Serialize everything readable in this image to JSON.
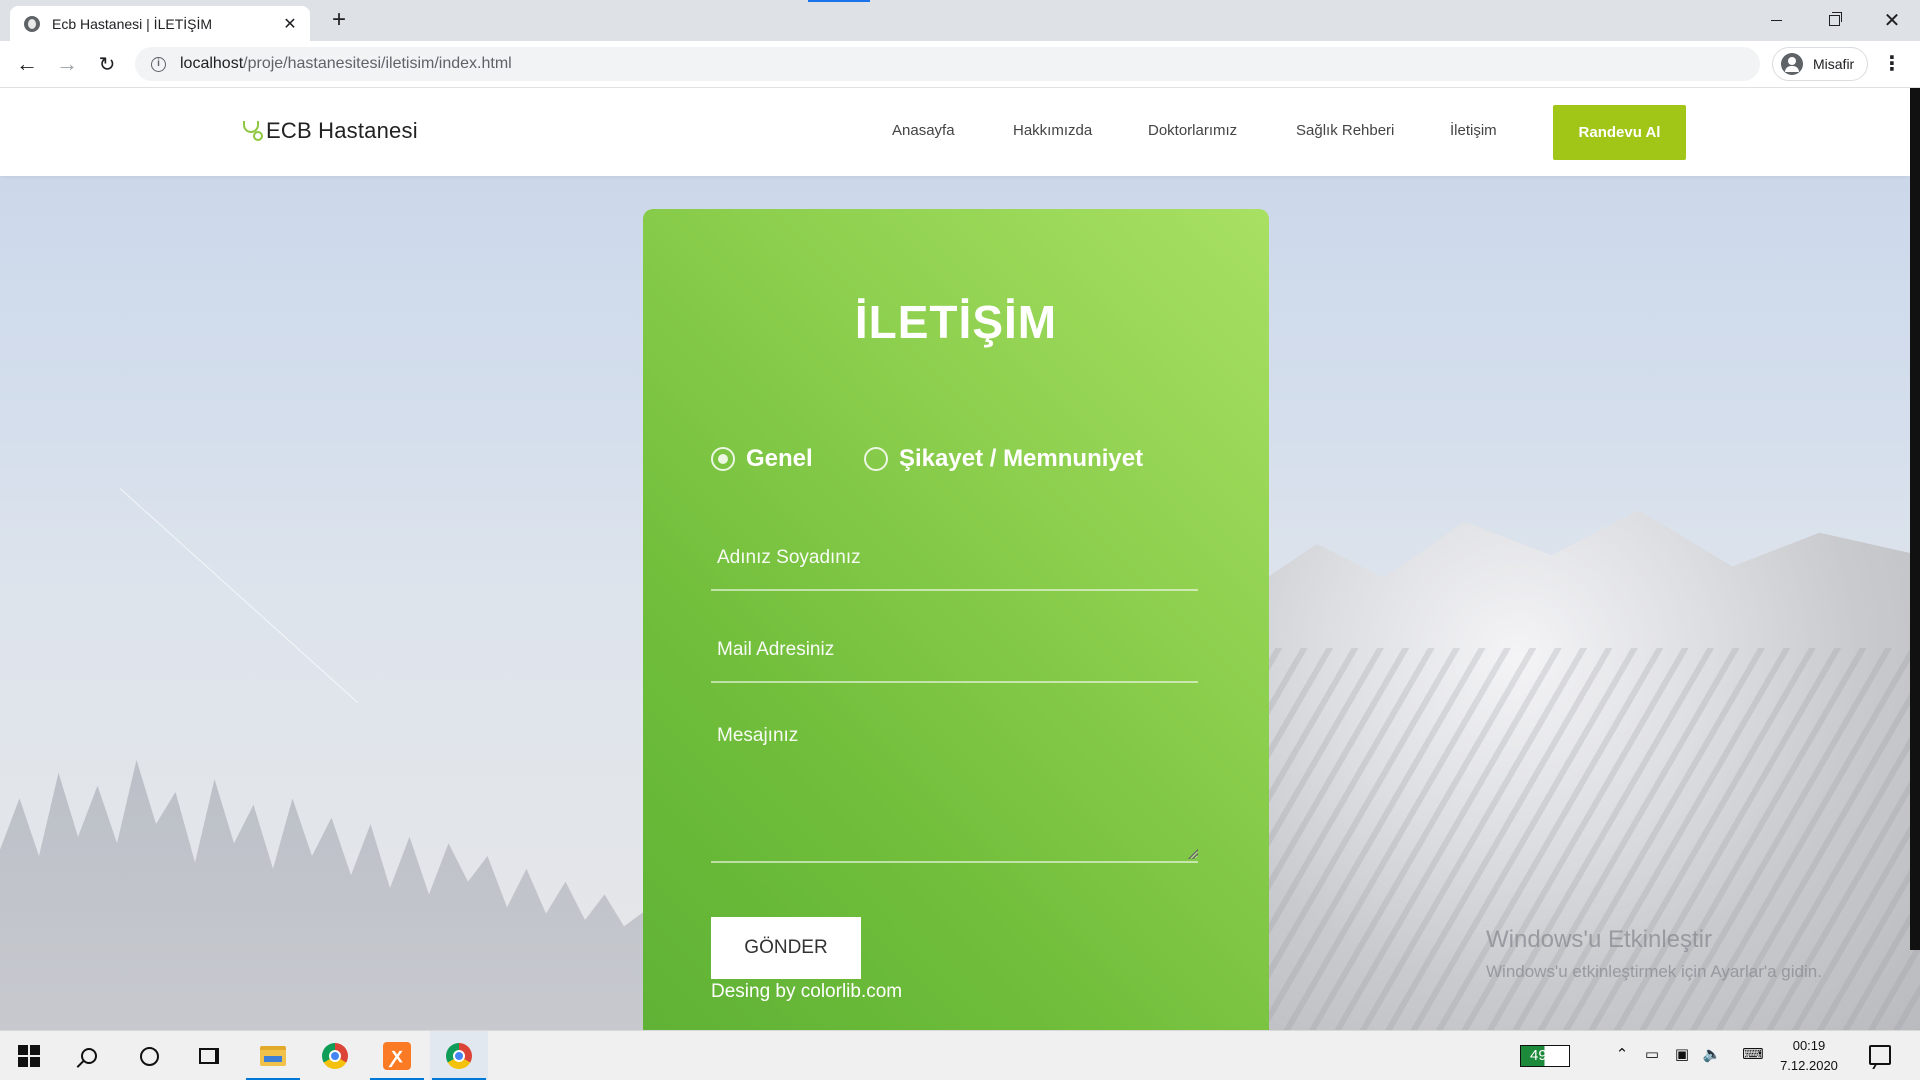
{
  "browser": {
    "tab_title": "Ecb Hastanesi | İLETİŞİM",
    "tab_close": "✕",
    "new_tab": "+",
    "url_host": "localhost",
    "url_path": "/proje/hastanesitesi/iletisim/index.html",
    "profile_name": "Misafir"
  },
  "site": {
    "brand": "ECB Hastanesi",
    "nav": [
      "Anasayfa",
      "Hakkımızda",
      "Doktorlarımız",
      "Sağlık Rehberi",
      "İletişim"
    ],
    "cta": "Randevu Al"
  },
  "contact": {
    "title": "İLETİŞİM",
    "options": [
      {
        "label": "Genel",
        "checked": true
      },
      {
        "label": "Şikayet / Memnuniyet",
        "checked": false
      }
    ],
    "name_placeholder": "Adınız Soyadınız",
    "mail_placeholder": "Mail Adresiniz",
    "message_placeholder": "Mesajınız",
    "submit": "GÖNDER",
    "credit": "Desing by colorlib.com"
  },
  "watermark": {
    "line1": "Windows'u Etkinleştir",
    "line2": "Windows'u etkinleştirmek için Ayarlar'a gidin."
  },
  "taskbar": {
    "battery": "49%",
    "time": "00:19",
    "date": "7.12.2020"
  },
  "colors": {
    "accent": "#8dc63f",
    "cta": "#a2c617",
    "card_light": "#a8e063",
    "card_dark": "#5fb236"
  }
}
